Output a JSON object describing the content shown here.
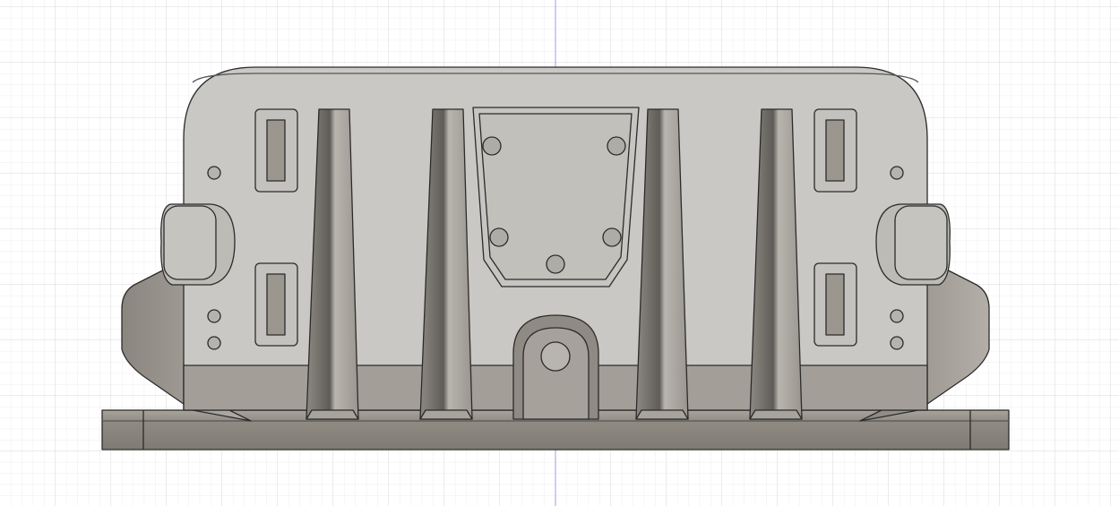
{
  "viewport": {
    "view": "front",
    "colors": {
      "background": "#ffffff",
      "grid_minor": "#ececec",
      "grid_major": "#d6d6d6",
      "axis": "#9aa0e6",
      "body_light": "#c9c8c4",
      "body_dark": "#a39f98",
      "base": "#8e8a82",
      "edge": "#2b2b2b"
    }
  }
}
